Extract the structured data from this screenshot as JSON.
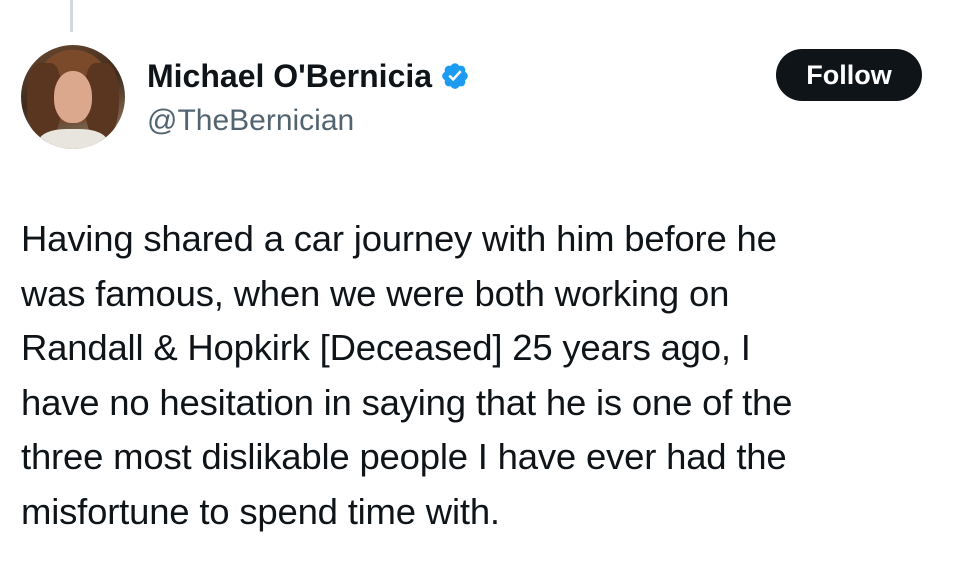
{
  "author": {
    "display_name": "Michael O'Bernicia",
    "handle": "@TheBernician",
    "verified": true,
    "avatar_icon": "profile-photo"
  },
  "actions": {
    "follow_label": "Follow"
  },
  "tweet": {
    "text": "Having shared a car journey with him before he\nwas famous, when we were both working on\nRandall & Hopkirk [Deceased] 25 years ago, I\nhave no hesitation in saying that he is one of the\nthree most dislikable people I have ever had the\nmisfortune to spend time with."
  },
  "colors": {
    "text_primary": "#0f1419",
    "text_secondary": "#536471",
    "verified_blue": "#1d9bf0",
    "button_bg": "#0f1419",
    "button_text": "#ffffff",
    "thread_line": "#cfd9de"
  }
}
